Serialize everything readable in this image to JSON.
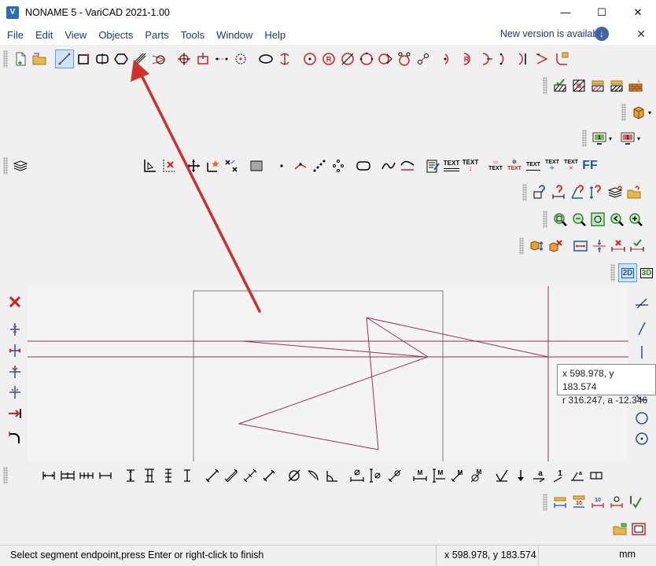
{
  "window": {
    "title": "NONAME 5 - VariCAD 2021-1.00",
    "logo": "V",
    "minimize": "—",
    "maximize": "☐",
    "close": "✕"
  },
  "menu": {
    "items": [
      "File",
      "Edit",
      "View",
      "Objects",
      "Parts",
      "Tools",
      "Window",
      "Help"
    ],
    "new_version": "New version is available",
    "close": "✕"
  },
  "toolbar_text": {
    "text1": "TEXT",
    "text2": "TEXT",
    "text3": "TEXT",
    "text4": "TEXT",
    "text5": "TEXT",
    "text6": "TEXT",
    "text7": "TEXT",
    "mode_2d": "2D",
    "mode_3d": "3D",
    "ff": "FF"
  },
  "tooltip": {
    "line1": "x 598.978, y 183.574",
    "line2": "r 316.247, a -12.346"
  },
  "status": {
    "message": "Select segment endpoint,press Enter or right-click to finish",
    "coords": "x 598.978, y 183.574",
    "units": "mm"
  },
  "colors": {
    "drawing_line": "#9a2f52",
    "annotation_arrow": "#d0302b",
    "selected_tool": "#cce4f7",
    "icon_red": "#d41f1f",
    "icon_blue": "#1e56a8"
  }
}
